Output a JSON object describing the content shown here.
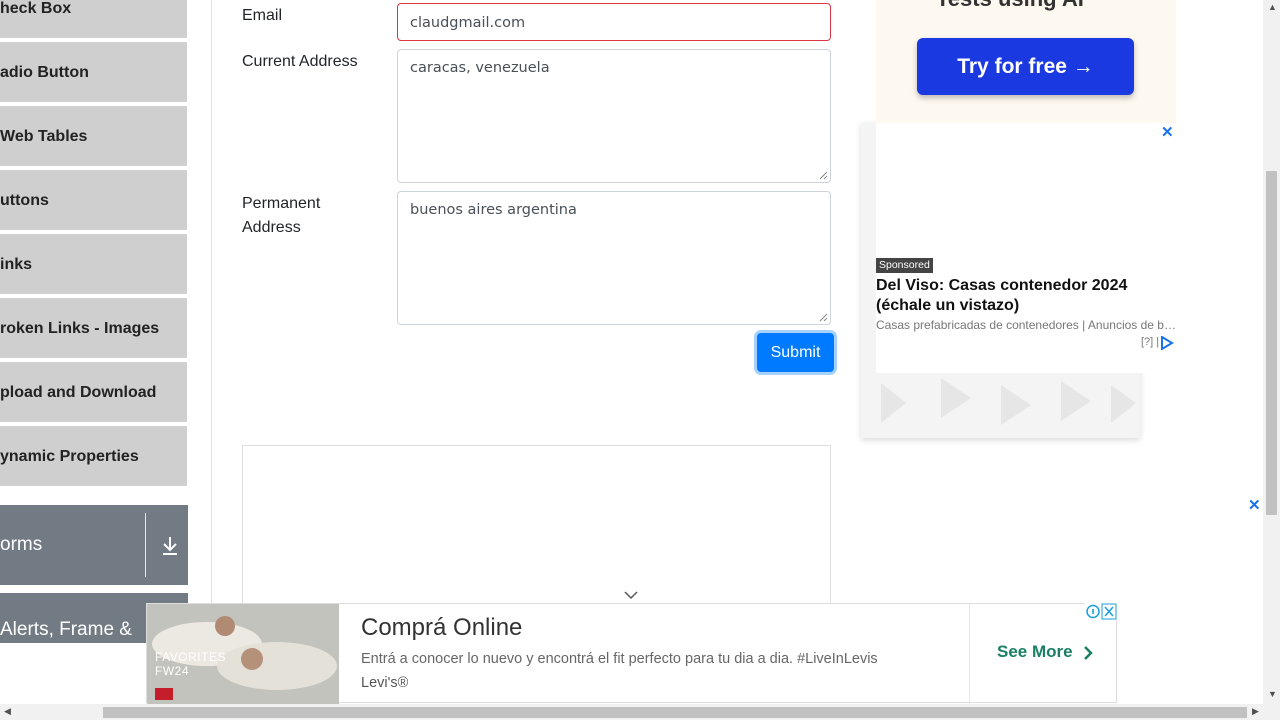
{
  "sidebar": {
    "items": [
      {
        "label": "heck Box"
      },
      {
        "label": "adio Button"
      },
      {
        "label": "Web Tables"
      },
      {
        "label": "uttons"
      },
      {
        "label": "inks"
      },
      {
        "label": "roken Links - Images"
      },
      {
        "label": "pload and Download"
      },
      {
        "label": "ynamic Properties"
      }
    ],
    "group_forms": "orms",
    "group_alerts": "Alerts, Frame &"
  },
  "form": {
    "email_label": "Email",
    "email_value": "claudgmail.com",
    "current_address_label": "Current Address",
    "current_address_value": "caracas, venezuela",
    "permanent_address_label_1": "Permanent",
    "permanent_address_label_2": "Address",
    "permanent_address_value": "buenos aires argentina",
    "submit_label": "Submit"
  },
  "right_ad": {
    "cut_headline": "Tests using AI",
    "cta": "Try for free →",
    "sponsored": "Sponsored",
    "title": "Del Viso: Casas contenedor 2024 (échale un vistazo)",
    "subtitle": "Casas prefabricadas de contenedores | Anuncios de b…",
    "info": "[?] |",
    "close": "✕"
  },
  "banner": {
    "image_text_1": "FAVORITES",
    "image_text_2": "FW24",
    "title": "Comprá Online",
    "description": "Entrá a conocer lo nuevo y encontrá el fit perfecto para tu dia a dia. #LiveInLevis",
    "brand": "Levi's®",
    "cta": "See More"
  },
  "colors": {
    "accent": "#007bff",
    "invalid_border": "#dc3545",
    "sidebar_item": "#cfcfcf",
    "group_header": "#727a84",
    "cta_blue": "#1a39e0",
    "see_more_green": "#1a7f64"
  }
}
